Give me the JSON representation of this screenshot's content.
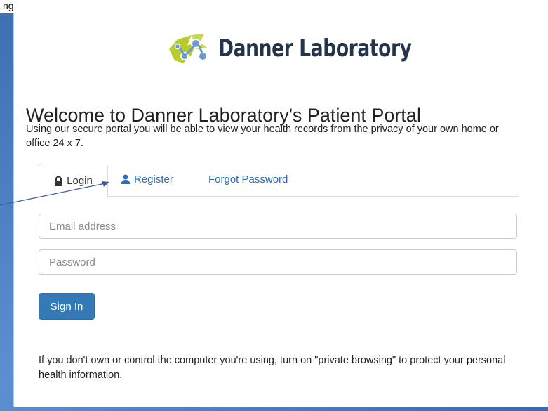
{
  "caption": "ng",
  "brand": {
    "name": "Danner Laboratory"
  },
  "welcome": {
    "title": "Welcome to Danner Laboratory's Patient Portal",
    "intro": "Using our secure portal you will be able to view your health records from the privacy of your own home or office 24 x 7."
  },
  "tabs": [
    {
      "label": "Login",
      "icon": "lock-icon",
      "active": true
    },
    {
      "label": "Register",
      "icon": "user-icon",
      "active": false
    },
    {
      "label": "Forgot Password",
      "icon": "",
      "active": false
    }
  ],
  "form": {
    "email_placeholder": "Email address",
    "password_placeholder": "Password",
    "sign_in_label": "Sign In"
  },
  "footer_note": "If you don't own or control the computer you're using, turn on \"private browsing\" to protect your personal health information.",
  "colors": {
    "accent": "#337ab7",
    "link": "#2a6cb6",
    "logo_green": "#b9cc2d",
    "logo_blue": "#5a8fc8",
    "brand_text": "#24344a",
    "background_blue": "#4a7fc2"
  }
}
